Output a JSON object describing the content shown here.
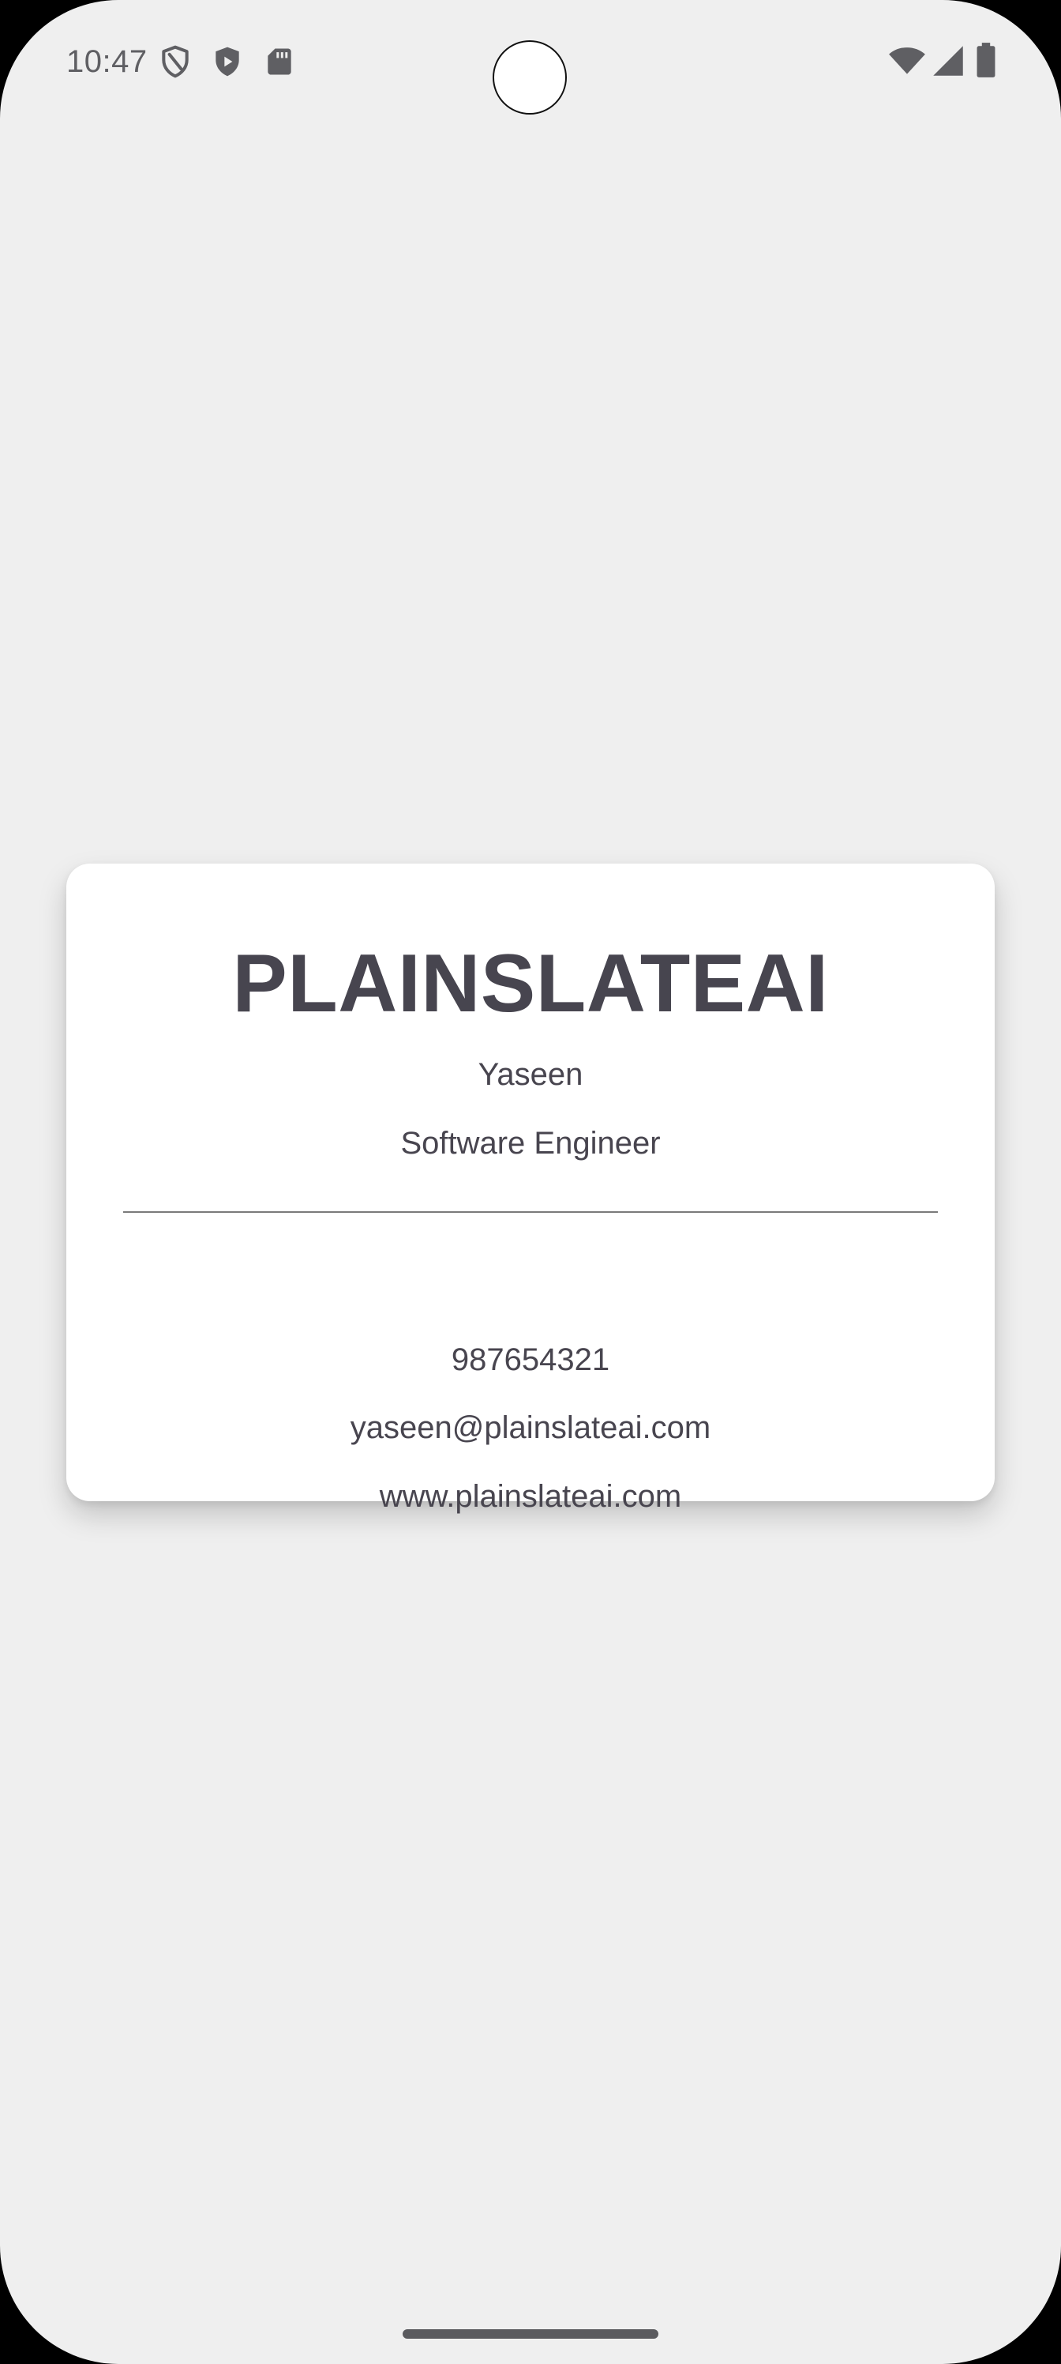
{
  "status_bar": {
    "time": "10:47",
    "left_icons": [
      "vpn-shield-icon",
      "play-protect-icon",
      "sd-card-icon"
    ],
    "right_icons": [
      "wifi-icon",
      "cell-signal-icon",
      "battery-icon"
    ]
  },
  "card": {
    "company": "PLAINSLATEAI",
    "name": "Yaseen",
    "title": "Software Engineer",
    "phone": "987654321",
    "email": "yaseen@plainslateai.com",
    "website": "www.plainslateai.com"
  },
  "colors": {
    "background": "#efefef",
    "card": "#ffffff",
    "text": "#48454f",
    "divider": "#7a7a7a"
  }
}
